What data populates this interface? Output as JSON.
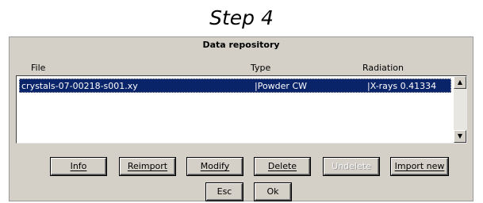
{
  "caption": "Step 4",
  "dialog": {
    "title": "Data repository",
    "columns": {
      "file": "File",
      "type": "Type",
      "radiation": "Radiation"
    },
    "rows": [
      {
        "file": "crystals-07-00218-s001.xy",
        "type": "|Powder CW",
        "radiation": "|X-rays 0.41334",
        "selected": true
      }
    ],
    "buttons": {
      "info": "Info",
      "reimport": "Reimport",
      "modify": "Modify",
      "delete": "Delete",
      "undelete": "Undelete",
      "import_new": "Import new",
      "esc": "Esc",
      "ok": "Ok"
    },
    "colors": {
      "selection": "#0a246a",
      "dialog_bg": "#d4d0c8"
    }
  }
}
